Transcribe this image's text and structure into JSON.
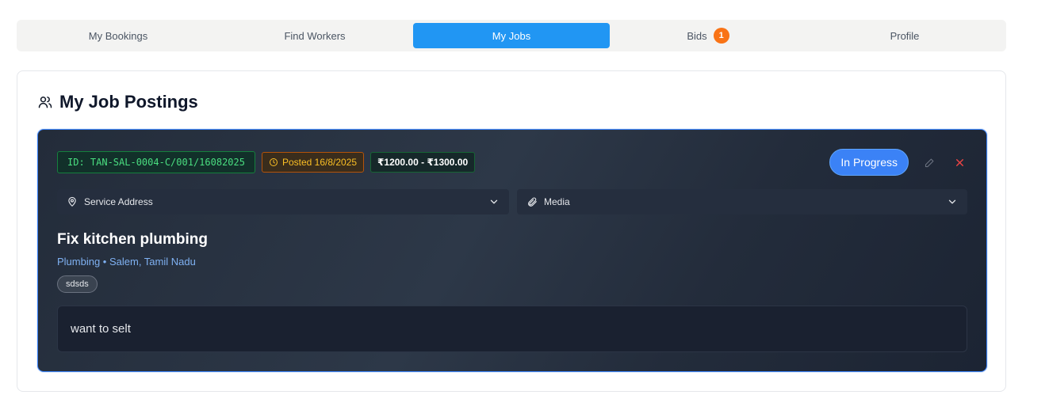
{
  "tabs": [
    {
      "label": "My Bookings",
      "active": false
    },
    {
      "label": "Find Workers",
      "active": false
    },
    {
      "label": "My Jobs",
      "active": true
    },
    {
      "label": "Bids",
      "active": false,
      "badge": "1"
    },
    {
      "label": "Profile",
      "active": false
    }
  ],
  "section": {
    "title": "My Job Postings",
    "icon": "users-icon"
  },
  "job": {
    "id": "ID: TAN-SAL-0004-C/001/16082025",
    "posted": "Posted 16/8/2025",
    "price_range": "₹1200.00 - ₹1300.00",
    "status": "In Progress",
    "service_address_label": "Service Address",
    "media_label": "Media",
    "title": "Fix kitchen plumbing",
    "meta": "Plumbing • Salem, Tamil Nadu",
    "tag": "sdsds",
    "description": "want to selt"
  },
  "colors": {
    "accent": "#2196f3",
    "badge_orange": "#f97316",
    "card_dark": "#2a3342",
    "id_green": "#4ade80",
    "posted_amber": "#fbbf24",
    "delete_red": "#ef4444"
  }
}
